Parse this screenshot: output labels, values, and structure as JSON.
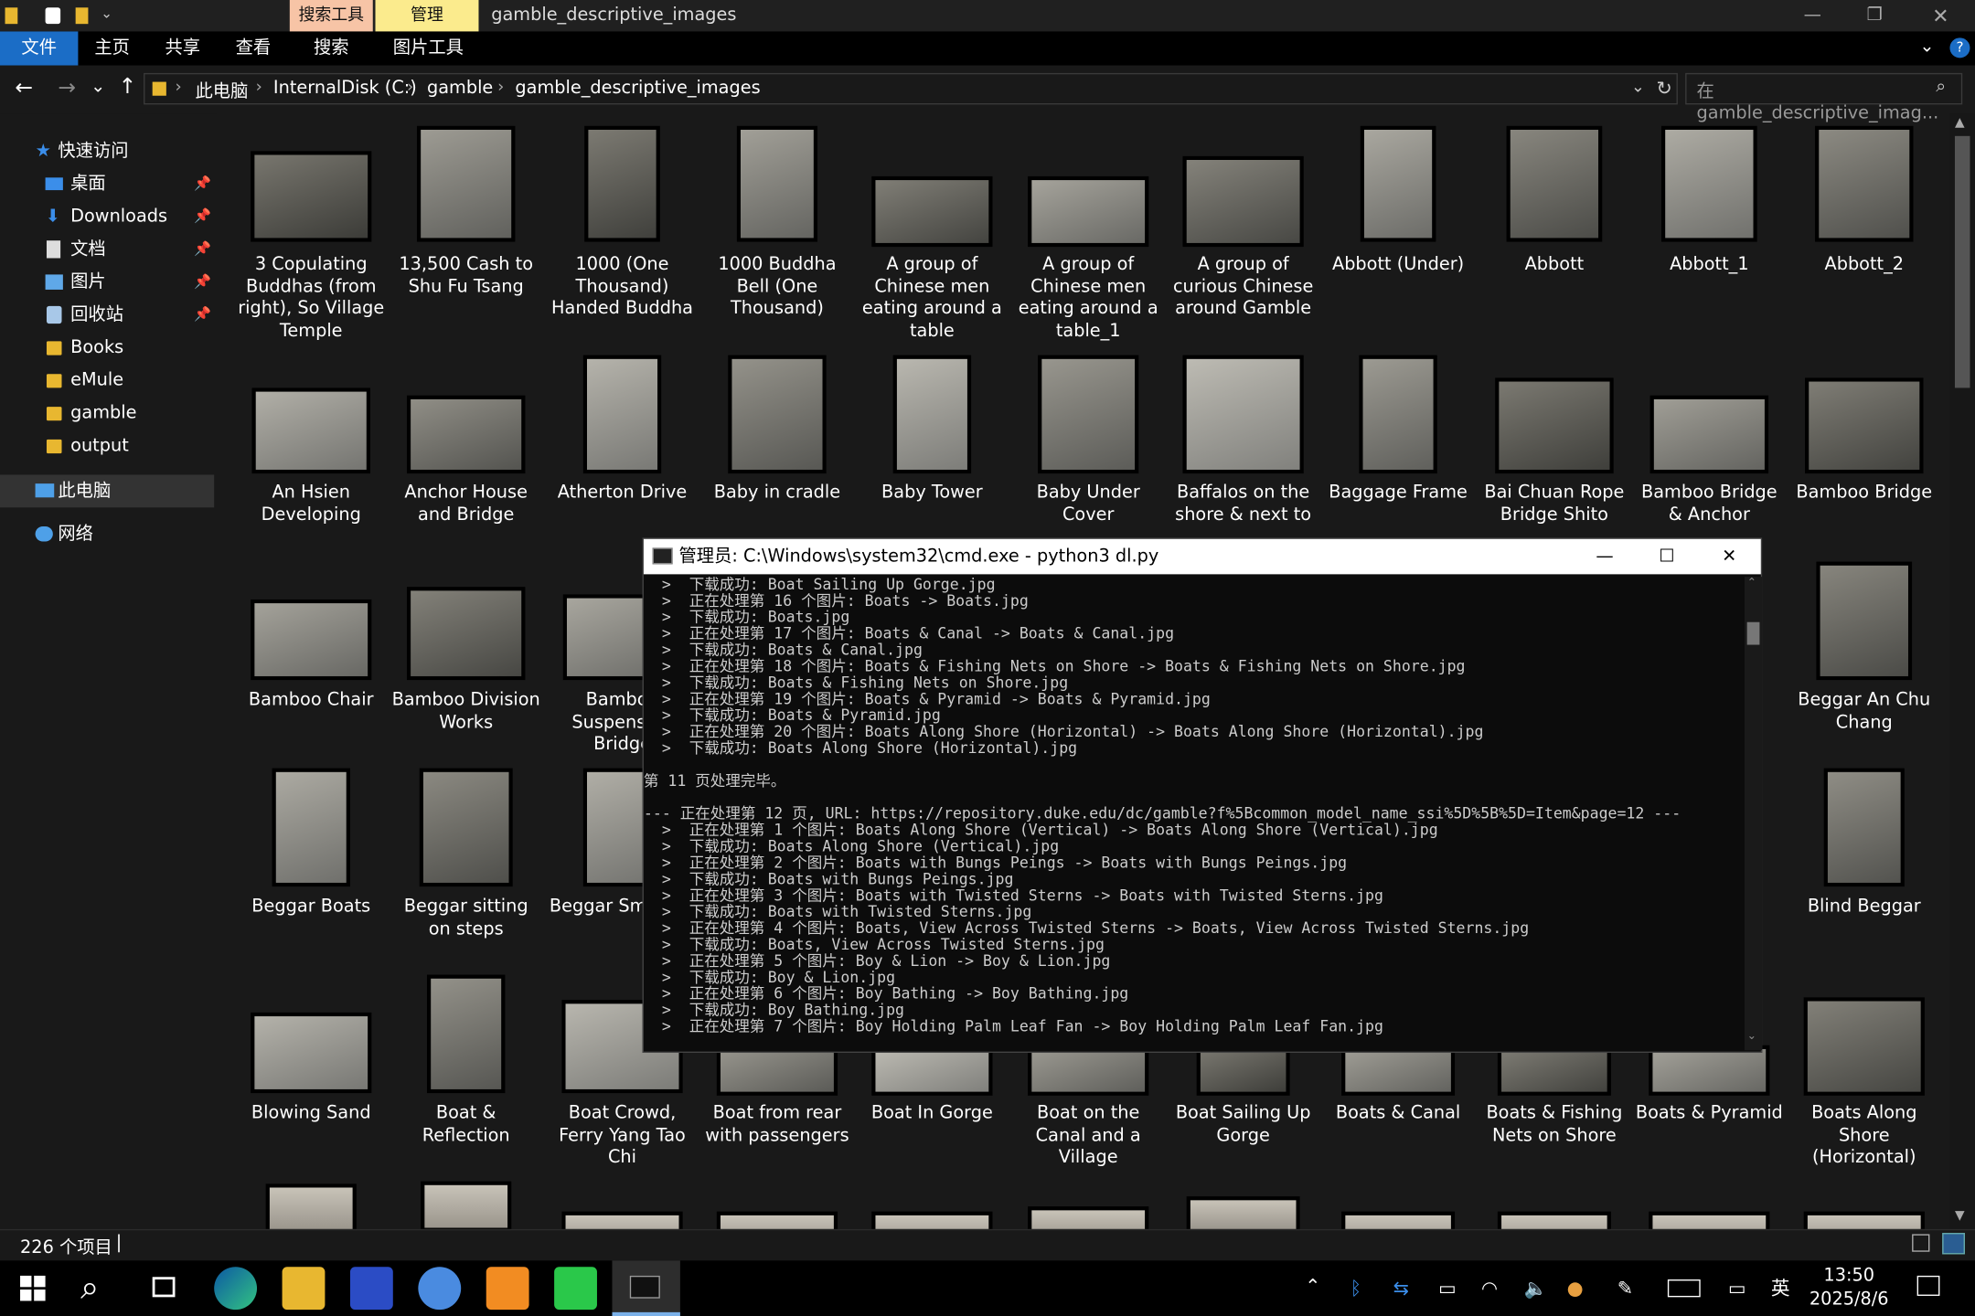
{
  "window": {
    "title": "gamble_descriptive_images",
    "ctx_search": "搜索工具",
    "ctx_manage": "管理"
  },
  "ribbon": {
    "tabs": [
      "文件",
      "主页",
      "共享",
      "查看",
      "搜索",
      "图片工具"
    ]
  },
  "address": {
    "crumbs": [
      "此电脑",
      "InternalDisk (C:)",
      "gamble",
      "gamble_descriptive_images"
    ],
    "search_placeholder": "在 gamble_descriptive_imag..."
  },
  "sidebar": {
    "quick_access": "快速访问",
    "items": [
      "桌面",
      "Downloads",
      "文档",
      "图片",
      "回收站",
      "Books",
      "eMule",
      "gamble",
      "output"
    ],
    "this_pc": "此电脑",
    "network": "网络"
  },
  "files": [
    "3 Copulating Buddhas (from right), So Village Temple",
    "13,500 Cash to Shu Fu Tsang",
    "1000 (One Thousand) Handed Buddha",
    "1000 Buddha Bell (One Thousand)",
    "A group of Chinese men eating around a table",
    "A group of Chinese men eating around a table_1",
    "A group of curious Chinese around Gamble",
    "Abbott  (Under)",
    "Abbott",
    "Abbott_1",
    "Abbott_2",
    "An Hsien Developing",
    "Anchor House and Bridge",
    "Atherton Drive",
    "Baby in cradle",
    "Baby Tower",
    "Baby Under Cover",
    "Baffalos on the shore & next to",
    "Baggage Frame",
    "Bai Chuan Rope Bridge Shito",
    "Bamboo Bridge & Anchor",
    "Bamboo Bridge",
    "Bamboo Chair",
    "Bamboo Division Works",
    "Bamboo Suspension Bridge",
    "Beggar An Chu Chang",
    "Beggar Boats",
    "Beggar sitting on steps",
    "Beggar Smoking",
    "Blind Beggar",
    "Blowing Sand",
    "Boat & Reflection",
    "Boat Crowd, Ferry Yang Tao Chi",
    "Boat from rear with passengers",
    "Boat In Gorge",
    "Boat on the Canal and a Village",
    "Boat Sailing Up Gorge",
    "Boats & Canal",
    "Boats & Fishing Nets on Shore",
    "Boats & Pyramid",
    "Boats Along Shore (Horizontal)"
  ],
  "cmd": {
    "title": "管理员: C:\\Windows\\system32\\cmd.exe - python3  dl.py",
    "lines": [
      "  >  下载成功: Boat Sailing Up Gorge.jpg",
      "  >  正在处理第 16 个图片: Boats -> Boats.jpg",
      "  >  下载成功: Boats.jpg",
      "  >  正在处理第 17 个图片: Boats & Canal -> Boats & Canal.jpg",
      "  >  下载成功: Boats & Canal.jpg",
      "  >  正在处理第 18 个图片: Boats & Fishing Nets on Shore -> Boats & Fishing Nets on Shore.jpg",
      "  >  下载成功: Boats & Fishing Nets on Shore.jpg",
      "  >  正在处理第 19 个图片: Boats & Pyramid -> Boats & Pyramid.jpg",
      "  >  下载成功: Boats & Pyramid.jpg",
      "  >  正在处理第 20 个图片: Boats Along Shore (Horizontal) -> Boats Along Shore (Horizontal).jpg",
      "  >  下载成功: Boats Along Shore (Horizontal).jpg",
      "",
      "第 11 页处理完毕。",
      "",
      "--- 正在处理第 12 页, URL: https://repository.duke.edu/dc/gamble?f%5Bcommon_model_name_ssi%5D%5B%5D=Item&page=12 ---",
      "  >  正在处理第 1 个图片: Boats Along Shore (Vertical) -> Boats Along Shore (Vertical).jpg",
      "  >  下载成功: Boats Along Shore (Vertical).jpg",
      "  >  正在处理第 2 个图片: Boats with Bungs Peings -> Boats with Bungs Peings.jpg",
      "  >  下载成功: Boats with Bungs Peings.jpg",
      "  >  正在处理第 3 个图片: Boats with Twisted Sterns -> Boats with Twisted Sterns.jpg",
      "  >  下载成功: Boats with Twisted Sterns.jpg",
      "  >  正在处理第 4 个图片: Boats, View Across Twisted Sterns -> Boats, View Across Twisted Sterns.jpg",
      "  >  下载成功: Boats, View Across Twisted Sterns.jpg",
      "  >  正在处理第 5 个图片: Boy & Lion -> Boy & Lion.jpg",
      "  >  下载成功: Boy & Lion.jpg",
      "  >  正在处理第 6 个图片: Boy Bathing -> Boy Bathing.jpg",
      "  >  下载成功: Boy Bathing.jpg",
      "  >  正在处理第 7 个图片: Boy Holding Palm Leaf Fan -> Boy Holding Palm Leaf Fan.jpg"
    ]
  },
  "status": {
    "count": "226 个项目"
  },
  "clock": {
    "time": "13:50",
    "date": "2025/8/6",
    "ime": "英"
  }
}
